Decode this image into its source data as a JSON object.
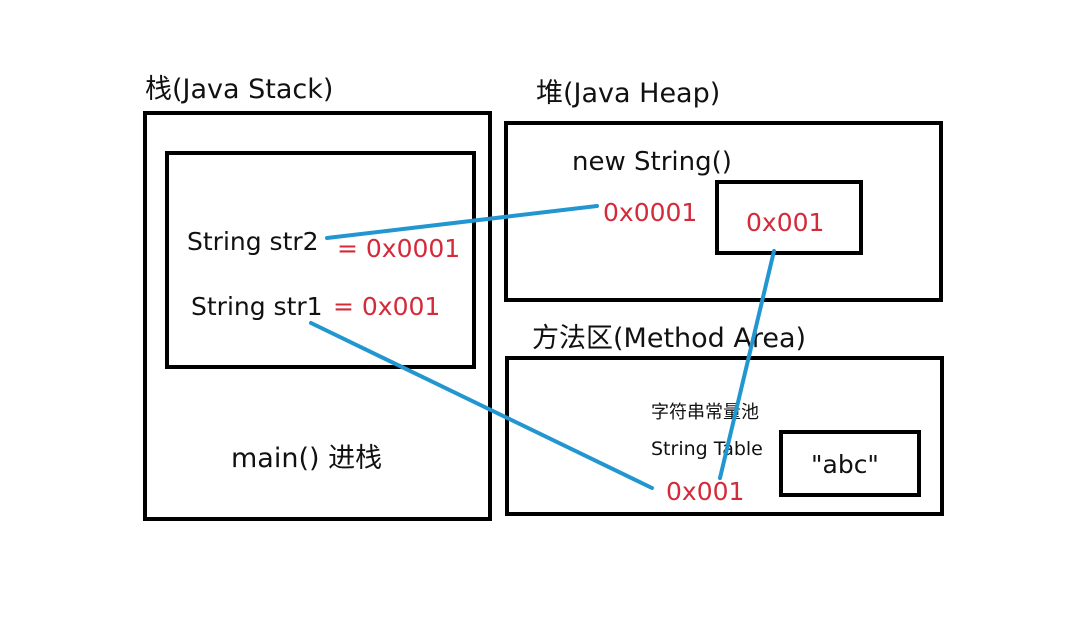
{
  "stack": {
    "title": "栈(Java Stack)",
    "frame": {
      "str2_label": "String str2",
      "str2_value": "= 0x0001",
      "str1_label": "String str1",
      "str1_value": "= 0x001"
    },
    "footer": "main() 进栈"
  },
  "heap": {
    "title": "堆(Java Heap)",
    "object_label": "new String()",
    "object_address": "0x0001",
    "inner_value": "0x001"
  },
  "method_area": {
    "title": "方法区(Method  Area)",
    "pool_label_cn": "字符串常量池",
    "pool_label_en": "String Table",
    "literal": "\"abc\"",
    "literal_address": "0x001"
  },
  "colors": {
    "border": "#000000",
    "address_text": "#d42a3a",
    "arrow": "#2196d0"
  }
}
